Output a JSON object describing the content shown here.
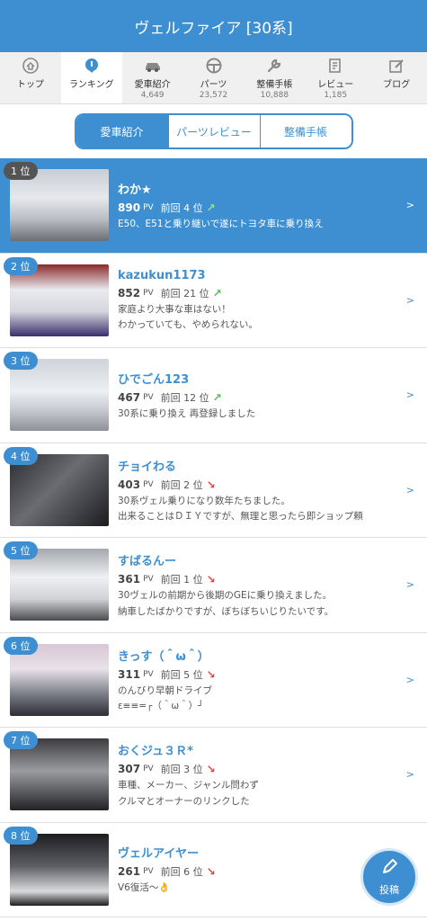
{
  "header": {
    "title": "ヴェルファイア [30系]"
  },
  "tabs": [
    {
      "label": "トップ",
      "count": "",
      "icon": "home-icon"
    },
    {
      "label": "ランキング",
      "count": "",
      "icon": "ranking-icon"
    },
    {
      "label": "愛車紹介",
      "count": "4,649",
      "icon": "car-icon"
    },
    {
      "label": "パーツ",
      "count": "23,572",
      "icon": "steering-wheel-icon"
    },
    {
      "label": "整備手帳",
      "count": "10,888",
      "icon": "wrench-icon"
    },
    {
      "label": "レビュー",
      "count": "1,185",
      "icon": "review-icon"
    },
    {
      "label": "ブログ",
      "count": "",
      "icon": "blog-icon"
    }
  ],
  "segments": [
    "愛車紹介",
    "パーツレビュー",
    "整備手帳"
  ],
  "ranking": [
    {
      "rank": "1 位",
      "name": "わか★",
      "pv": "890",
      "unit": "PV",
      "prev": "前回 4 位",
      "trend": "up",
      "desc1": "E50、E51と乗り継いで遂にトヨタ車に乗り換え",
      "desc2": ""
    },
    {
      "rank": "2 位",
      "name": "kazukun1173",
      "pv": "852",
      "unit": "PV",
      "prev": "前回 21 位",
      "trend": "up",
      "desc1": "家庭より大事な車はない！",
      "desc2": "わかっていても、やめられない。"
    },
    {
      "rank": "3 位",
      "name": "ひでごん123",
      "pv": "467",
      "unit": "PV",
      "prev": "前回 12 位",
      "trend": "up",
      "desc1": "30系に乗り換え 再登録しました",
      "desc2": ""
    },
    {
      "rank": "4 位",
      "name": "チョイわる",
      "pv": "403",
      "unit": "PV",
      "prev": "前回 2 位",
      "trend": "down",
      "desc1": "30系ヴェル乗りになり数年たちました。",
      "desc2": "出来ることはＤＩＹですが、無理と思ったら即ショップ頼"
    },
    {
      "rank": "5 位",
      "name": "すばるんー",
      "pv": "361",
      "unit": "PV",
      "prev": "前回 1 位",
      "trend": "down",
      "desc1": "30ヴェルの前期から後期のGEに乗り換えました。",
      "desc2": "納車したばかりですが、ぼちぼちいじりたいです。"
    },
    {
      "rank": "6 位",
      "name": "きっす（＾ω＾）",
      "pv": "311",
      "unit": "PV",
      "prev": "前回 5 位",
      "trend": "down",
      "desc1": "のんびり早朝ドライブ",
      "desc2": "ε≡≡=┌（＾ω＾）┘"
    },
    {
      "rank": "7 位",
      "name": "おくジュ３Ｒ*",
      "pv": "307",
      "unit": "PV",
      "prev": "前回 3 位",
      "trend": "down",
      "desc1": "車種、メーカー、ジャンル問わず",
      "desc2": "クルマとオーナーのリンクした"
    },
    {
      "rank": "8 位",
      "name": "ヴェルアイヤー",
      "pv": "261",
      "unit": "PV",
      "prev": "前回 6 位",
      "trend": "down",
      "desc1": "V6復活〜👌",
      "desc2": ""
    }
  ],
  "fab": {
    "label": "投稿",
    "icon": "pen-icon"
  },
  "colors": {
    "accent": "#3d8fd1",
    "up": "#5cb85c",
    "down": "#e0443a"
  }
}
